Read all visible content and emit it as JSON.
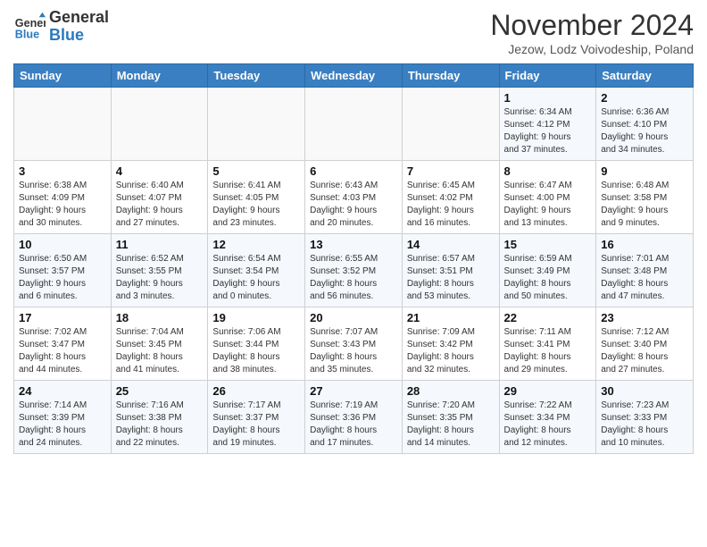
{
  "header": {
    "logo_general": "General",
    "logo_blue": "Blue",
    "title": "November 2024",
    "subtitle": "Jezow, Lodz Voivodeship, Poland"
  },
  "days_of_week": [
    "Sunday",
    "Monday",
    "Tuesday",
    "Wednesday",
    "Thursday",
    "Friday",
    "Saturday"
  ],
  "weeks": [
    [
      {
        "day": "",
        "info": ""
      },
      {
        "day": "",
        "info": ""
      },
      {
        "day": "",
        "info": ""
      },
      {
        "day": "",
        "info": ""
      },
      {
        "day": "",
        "info": ""
      },
      {
        "day": "1",
        "info": "Sunrise: 6:34 AM\nSunset: 4:12 PM\nDaylight: 9 hours\nand 37 minutes."
      },
      {
        "day": "2",
        "info": "Sunrise: 6:36 AM\nSunset: 4:10 PM\nDaylight: 9 hours\nand 34 minutes."
      }
    ],
    [
      {
        "day": "3",
        "info": "Sunrise: 6:38 AM\nSunset: 4:09 PM\nDaylight: 9 hours\nand 30 minutes."
      },
      {
        "day": "4",
        "info": "Sunrise: 6:40 AM\nSunset: 4:07 PM\nDaylight: 9 hours\nand 27 minutes."
      },
      {
        "day": "5",
        "info": "Sunrise: 6:41 AM\nSunset: 4:05 PM\nDaylight: 9 hours\nand 23 minutes."
      },
      {
        "day": "6",
        "info": "Sunrise: 6:43 AM\nSunset: 4:03 PM\nDaylight: 9 hours\nand 20 minutes."
      },
      {
        "day": "7",
        "info": "Sunrise: 6:45 AM\nSunset: 4:02 PM\nDaylight: 9 hours\nand 16 minutes."
      },
      {
        "day": "8",
        "info": "Sunrise: 6:47 AM\nSunset: 4:00 PM\nDaylight: 9 hours\nand 13 minutes."
      },
      {
        "day": "9",
        "info": "Sunrise: 6:48 AM\nSunset: 3:58 PM\nDaylight: 9 hours\nand 9 minutes."
      }
    ],
    [
      {
        "day": "10",
        "info": "Sunrise: 6:50 AM\nSunset: 3:57 PM\nDaylight: 9 hours\nand 6 minutes."
      },
      {
        "day": "11",
        "info": "Sunrise: 6:52 AM\nSunset: 3:55 PM\nDaylight: 9 hours\nand 3 minutes."
      },
      {
        "day": "12",
        "info": "Sunrise: 6:54 AM\nSunset: 3:54 PM\nDaylight: 9 hours\nand 0 minutes."
      },
      {
        "day": "13",
        "info": "Sunrise: 6:55 AM\nSunset: 3:52 PM\nDaylight: 8 hours\nand 56 minutes."
      },
      {
        "day": "14",
        "info": "Sunrise: 6:57 AM\nSunset: 3:51 PM\nDaylight: 8 hours\nand 53 minutes."
      },
      {
        "day": "15",
        "info": "Sunrise: 6:59 AM\nSunset: 3:49 PM\nDaylight: 8 hours\nand 50 minutes."
      },
      {
        "day": "16",
        "info": "Sunrise: 7:01 AM\nSunset: 3:48 PM\nDaylight: 8 hours\nand 47 minutes."
      }
    ],
    [
      {
        "day": "17",
        "info": "Sunrise: 7:02 AM\nSunset: 3:47 PM\nDaylight: 8 hours\nand 44 minutes."
      },
      {
        "day": "18",
        "info": "Sunrise: 7:04 AM\nSunset: 3:45 PM\nDaylight: 8 hours\nand 41 minutes."
      },
      {
        "day": "19",
        "info": "Sunrise: 7:06 AM\nSunset: 3:44 PM\nDaylight: 8 hours\nand 38 minutes."
      },
      {
        "day": "20",
        "info": "Sunrise: 7:07 AM\nSunset: 3:43 PM\nDaylight: 8 hours\nand 35 minutes."
      },
      {
        "day": "21",
        "info": "Sunrise: 7:09 AM\nSunset: 3:42 PM\nDaylight: 8 hours\nand 32 minutes."
      },
      {
        "day": "22",
        "info": "Sunrise: 7:11 AM\nSunset: 3:41 PM\nDaylight: 8 hours\nand 29 minutes."
      },
      {
        "day": "23",
        "info": "Sunrise: 7:12 AM\nSunset: 3:40 PM\nDaylight: 8 hours\nand 27 minutes."
      }
    ],
    [
      {
        "day": "24",
        "info": "Sunrise: 7:14 AM\nSunset: 3:39 PM\nDaylight: 8 hours\nand 24 minutes."
      },
      {
        "day": "25",
        "info": "Sunrise: 7:16 AM\nSunset: 3:38 PM\nDaylight: 8 hours\nand 22 minutes."
      },
      {
        "day": "26",
        "info": "Sunrise: 7:17 AM\nSunset: 3:37 PM\nDaylight: 8 hours\nand 19 minutes."
      },
      {
        "day": "27",
        "info": "Sunrise: 7:19 AM\nSunset: 3:36 PM\nDaylight: 8 hours\nand 17 minutes."
      },
      {
        "day": "28",
        "info": "Sunrise: 7:20 AM\nSunset: 3:35 PM\nDaylight: 8 hours\nand 14 minutes."
      },
      {
        "day": "29",
        "info": "Sunrise: 7:22 AM\nSunset: 3:34 PM\nDaylight: 8 hours\nand 12 minutes."
      },
      {
        "day": "30",
        "info": "Sunrise: 7:23 AM\nSunset: 3:33 PM\nDaylight: 8 hours\nand 10 minutes."
      }
    ]
  ]
}
